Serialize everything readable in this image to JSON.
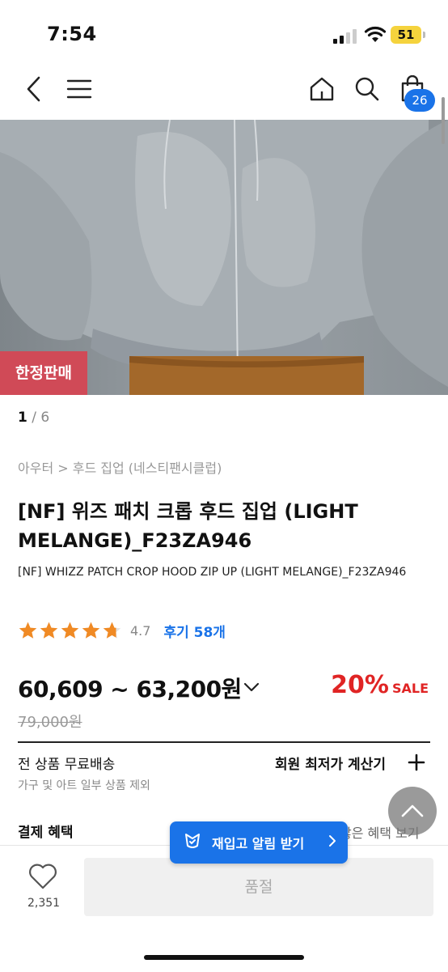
{
  "status_bar": {
    "time": "7:54",
    "battery": "51"
  },
  "nav": {
    "back_icon": "chevron-left-icon",
    "menu_icon": "hamburger-icon",
    "home_icon": "home-icon",
    "search_icon": "search-icon",
    "cart_icon": "shopping-bag-icon",
    "cart_count": "26"
  },
  "hero": {
    "badge": "한정판매",
    "pager_current": "1",
    "pager_sep": " / ",
    "pager_total": "6"
  },
  "product": {
    "breadcrumb": "아우터 > 후드 집업 (네스티팬시클럽)",
    "title": "[NF] 위즈 패치 크롭 후드 집업 (LIGHT MELANGE)_F23ZA946",
    "subtitle": "[NF] WHIZZ PATCH CROP HOOD ZIP UP (LIGHT MELANGE)_F23ZA946",
    "rating_value": "4.7",
    "rating_stars": 4.7,
    "review_label": "후기 58개",
    "price_range": "60,609 ~ 63,200원",
    "discount_pct": "20%",
    "discount_label": "SALE",
    "original_price": "79,000원"
  },
  "shipping": {
    "title": "전 상품 무료배송",
    "note": "가구 및 아트 일부 상품 제외",
    "calc_label": "회원 최저가 계산기"
  },
  "payment": {
    "title": "결제 혜택",
    "more_label": "많은 혜택 보기"
  },
  "restock": {
    "label": "재입고 알림 받기"
  },
  "bottom": {
    "like_count": "2,351",
    "soldout_label": "품절"
  },
  "colors": {
    "accent": "#1a73e8",
    "sale": "#e02424",
    "badge": "#d04a57",
    "star": "#f08a24"
  }
}
